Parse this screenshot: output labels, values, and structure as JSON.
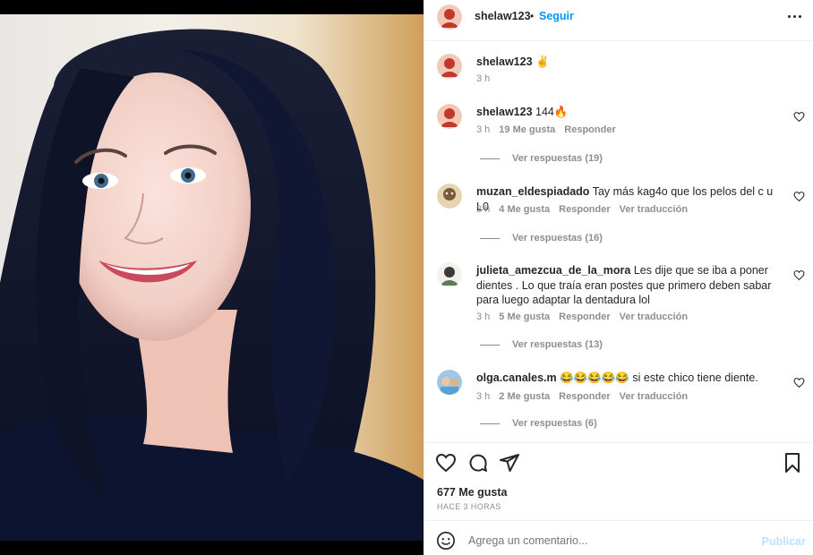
{
  "post": {
    "author": "shelaw123",
    "separator": "•",
    "follow_label": "Seguir"
  },
  "caption": {
    "username": "shelaw123",
    "text": "✌",
    "time": "3 h"
  },
  "comments": [
    {
      "username": "shelaw123",
      "text": "144🔥",
      "time": "3 h",
      "likes": "19 Me gusta",
      "reply": "Responder",
      "translate": "",
      "view_replies": "Ver respuestas (19)"
    },
    {
      "username": "muzan_eldespiadado",
      "text": "Tay más kag4o que los pelos del c u L0",
      "time": "3 h",
      "likes": "4 Me gusta",
      "reply": "Responder",
      "translate": "Ver traducción",
      "view_replies": "Ver respuestas (16)"
    },
    {
      "username": "julieta_amezcua_de_la_mora",
      "text": "Les dije que se iba a poner dientes . Lo que traía eran postes que primero deben sabar para luego adaptar la dentadura lol",
      "time": "3 h",
      "likes": "5 Me gusta",
      "reply": "Responder",
      "translate": "Ver traducción",
      "view_replies": "Ver respuestas (13)"
    },
    {
      "username": "olga.canales.m",
      "text": "😂😂😂😂😂 si este chico tiene diente.",
      "time": "3 h",
      "likes": "2 Me gusta",
      "reply": "Responder",
      "translate": "Ver traducción",
      "view_replies": "Ver respuestas (6)"
    }
  ],
  "stats": {
    "likes": "677 Me gusta",
    "posted": "HACE 3 HORAS"
  },
  "composer": {
    "placeholder": "Agrega un comentario...",
    "publish_label": "Publicar"
  },
  "icons": [
    "heart-icon",
    "comment-icon",
    "share-icon",
    "bookmark-icon",
    "emoji-icon",
    "more-options-icon"
  ],
  "colors": {
    "accent": "#0095f6",
    "muted": "#8e8e8e",
    "text": "#262626"
  }
}
